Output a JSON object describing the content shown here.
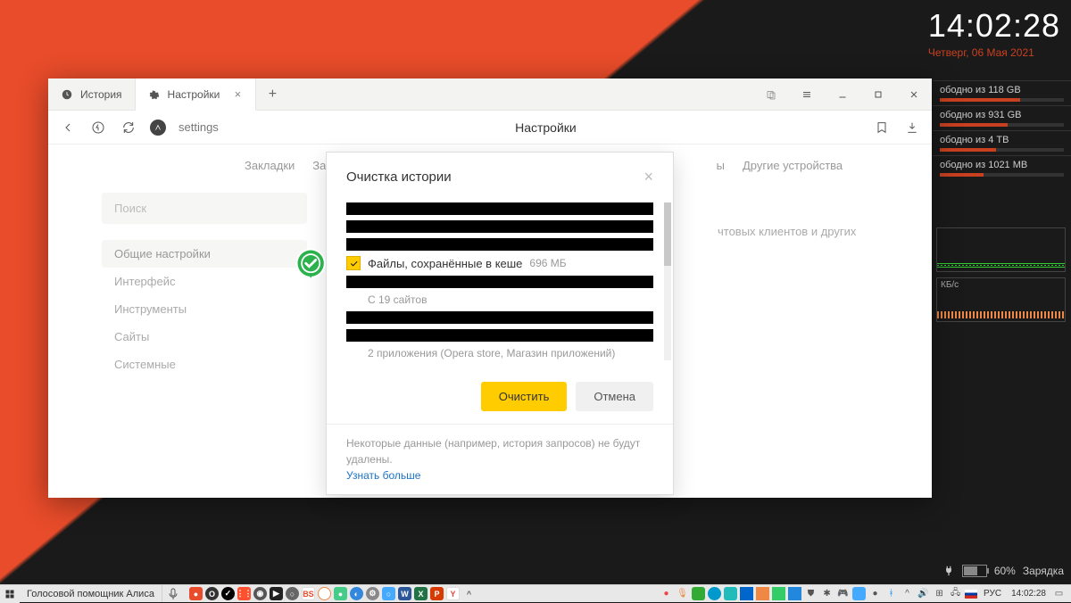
{
  "clock": {
    "time": "14:02:28",
    "date": "Четверг, 06 Мая 2021"
  },
  "disks": [
    {
      "label": "ободно из 118 GB",
      "pct": 65
    },
    {
      "label": "ободно из 931 GB",
      "pct": 55
    },
    {
      "label": "ободно из 4 ТВ",
      "pct": 45
    },
    {
      "label": "ободно из 1021 MB",
      "pct": 35
    }
  ],
  "net": {
    "unit": "КБ/с"
  },
  "battery": {
    "pct": "60%",
    "status": "Зарядка"
  },
  "browser": {
    "tabs": [
      {
        "label": "История"
      },
      {
        "label": "Настройки",
        "active": true
      }
    ],
    "omnibox": "settings",
    "page_title": "Настройки",
    "nav_tabs": [
      "Закладки",
      "Загрузки",
      "ы",
      "Другие устройства"
    ],
    "sidebar": {
      "search_placeholder": "Поиск",
      "items": [
        "Общие настройки",
        "Интерфейс",
        "Инструменты",
        "Сайты",
        "Системные"
      ]
    },
    "bg_text": "чтовых клиентов и других"
  },
  "modal": {
    "title": "Очистка истории",
    "cache_label": "Файлы, сохранённые в кеше",
    "cache_size": "696 МБ",
    "sites_count": "С 19 сайтов",
    "apps_count": "2 приложения (Opera store, Магазин приложений)",
    "clear_btn": "Очистить",
    "cancel_btn": "Отмена",
    "footer_text": "Некоторые данные (например, история запросов) не будут удалены.",
    "footer_link": "Узнать больше"
  },
  "taskbar": {
    "assistant": "Голосовой помощник Алиса",
    "lang": "РУС",
    "time": "14:02:28"
  }
}
